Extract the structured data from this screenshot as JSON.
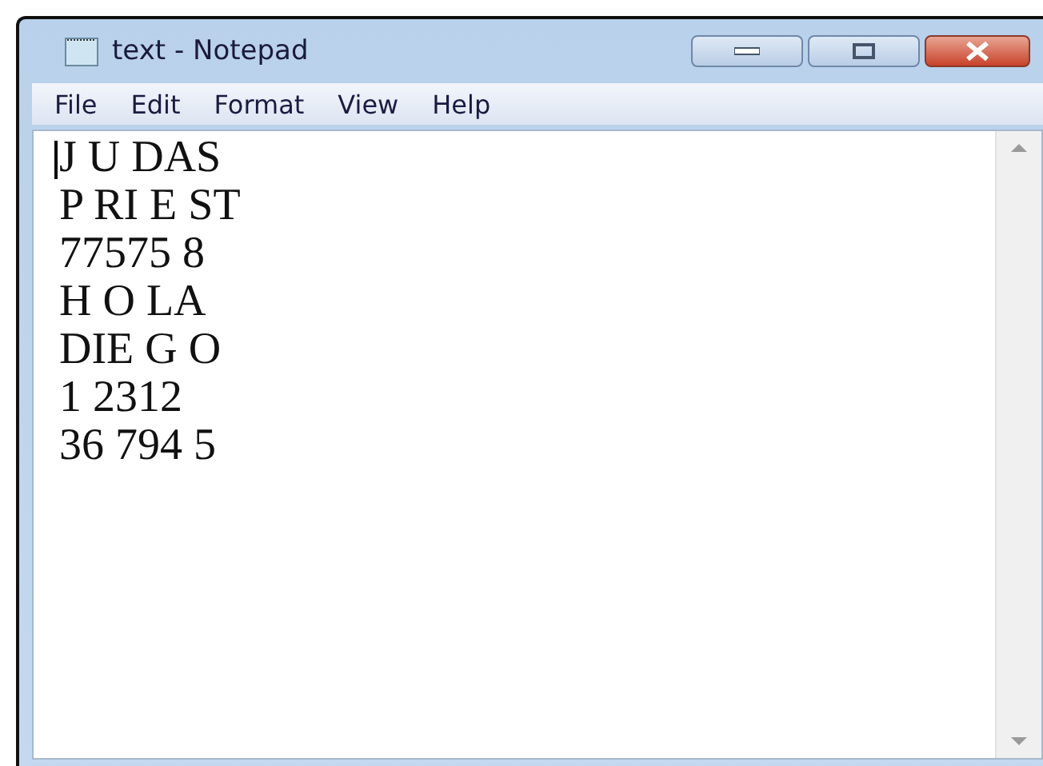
{
  "window": {
    "title": "text - Notepad"
  },
  "menu": [
    "File",
    "Edit",
    "Format",
    "View",
    "Help"
  ],
  "document": {
    "lines": [
      "J U DAS",
      "P RI E ST",
      "77575 8",
      "H O LA",
      "DIE G O",
      "1 2312",
      "36 794 5"
    ]
  }
}
